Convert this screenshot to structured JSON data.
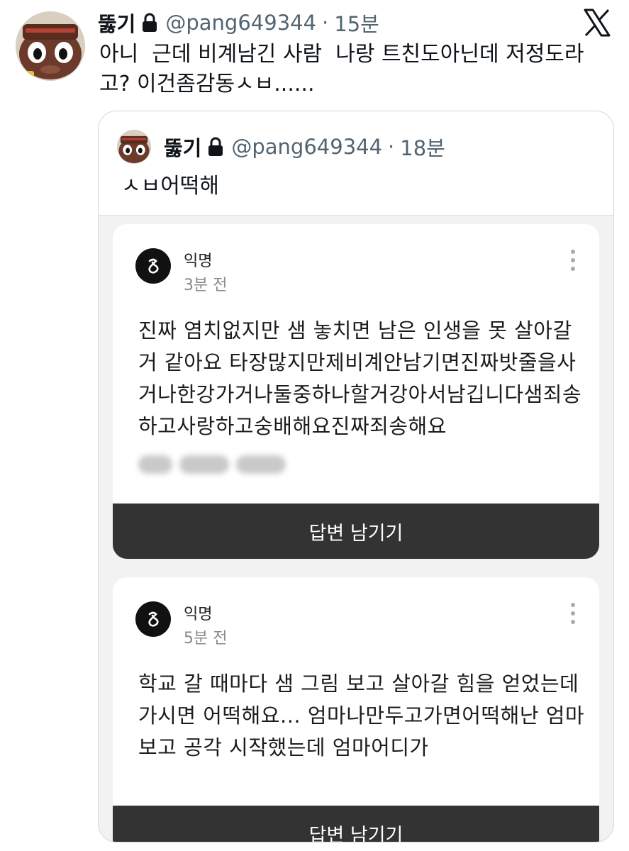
{
  "tweet": {
    "display_name": "뚫기",
    "handle": "@pang649344",
    "separator": "·",
    "time": "15분",
    "text": "아니  근데 비계남긴 사람  나랑 트친도아닌데 저정도라\n고? 이건좀감동ㅅㅂ......"
  },
  "quoted_tweet": {
    "display_name": "뚫기",
    "handle": "@pang649344",
    "separator": "·",
    "time": "18분",
    "text": "ㅅㅂ어떡해"
  },
  "embed": {
    "cards": [
      {
        "author": "익명",
        "time": "3분 전",
        "body": "진짜 염치없지만 샘 놓치면 남은 인생을 못 살아갈 거 같아요 타장많지만제비계안남기면진짜밧줄을사거나한강가거나둘중하나할거강아서남깁니다샘죄송하고사랑하고숭배해요진짜죄송해요",
        "button": "답변 남기기"
      },
      {
        "author": "익명",
        "time": "5분 전",
        "body": "학교 갈 때마다 샘 그림 보고 살아갈 힘을 얻었는데 가시면 어떡해요... 엄마나만두고가면어떡해난 엄마보고 공각 시작했는데 엄마어디가",
        "button": "답변 남기기"
      }
    ]
  },
  "icons": {
    "lock": "lock-icon",
    "platform": "x-logo-icon",
    "more": "more-vertical-icon",
    "anon": "anonymous-logo-icon"
  },
  "colors": {
    "text": "#0f1419",
    "muted": "#536471",
    "embed_bg": "#f2f2f2",
    "button_bg": "#333333"
  }
}
